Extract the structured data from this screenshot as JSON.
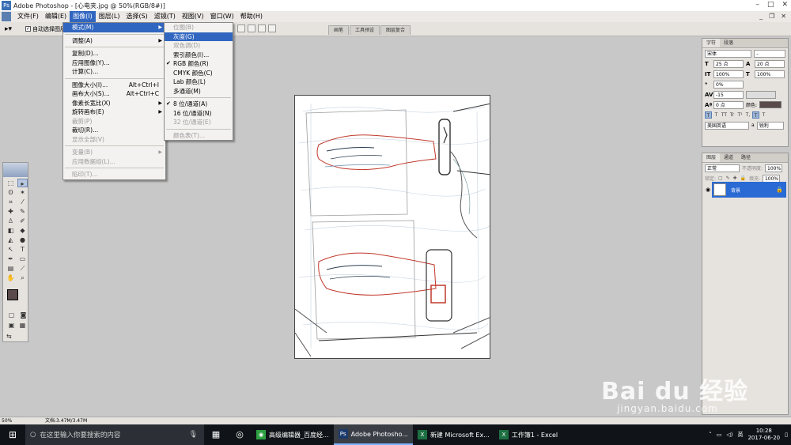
{
  "window": {
    "title": "Adobe Photoshop - [心电夹.jpg @ 50%(RGB/8#)]"
  },
  "menubar": [
    "文件(F)",
    "编辑(E)",
    "图像(I)",
    "图层(L)",
    "选择(S)",
    "滤镜(T)",
    "视图(V)",
    "窗口(W)",
    "帮助(H)"
  ],
  "options": {
    "auto_select": "自动选择图层",
    "tabs": [
      "画笔",
      "工具预设",
      "图层复合"
    ]
  },
  "image_menu": [
    {
      "label": "模式(M)",
      "arrow": true,
      "hl": true
    },
    {
      "sep": true
    },
    {
      "label": "调整(A)",
      "arrow": true
    },
    {
      "sep": true
    },
    {
      "label": "复制(D)..."
    },
    {
      "label": "应用图像(Y)..."
    },
    {
      "label": "计算(C)..."
    },
    {
      "sep": true
    },
    {
      "label": "图像大小(I)...",
      "sc": "Alt+Ctrl+I"
    },
    {
      "label": "画布大小(S)...",
      "sc": "Alt+Ctrl+C"
    },
    {
      "label": "像素长宽比(X)",
      "arrow": true
    },
    {
      "label": "旋转画布(E)",
      "arrow": true
    },
    {
      "label": "裁剪(P)",
      "disabled": true
    },
    {
      "label": "裁切(R)..."
    },
    {
      "label": "显示全部(V)",
      "disabled": true
    },
    {
      "sep": true
    },
    {
      "label": "变量(B)",
      "arrow": true,
      "disabled": true
    },
    {
      "label": "应用数据组(L)...",
      "disabled": true
    },
    {
      "sep": true
    },
    {
      "label": "陷印(T)...",
      "disabled": true
    }
  ],
  "mode_menu": [
    {
      "label": "位图(B)",
      "disabled": true
    },
    {
      "label": "灰度(G)",
      "hl": true
    },
    {
      "label": "双色调(D)",
      "disabled": true
    },
    {
      "label": "索引颜色(I)..."
    },
    {
      "label": "RGB 颜色(R)",
      "check": true
    },
    {
      "label": "CMYK 颜色(C)"
    },
    {
      "label": "Lab 颜色(L)"
    },
    {
      "label": "多通道(M)"
    },
    {
      "sep": true
    },
    {
      "label": "8 位/通道(A)",
      "check": true
    },
    {
      "label": "16 位/通道(N)"
    },
    {
      "label": "32 位/通道(E)",
      "disabled": true
    },
    {
      "sep": true
    },
    {
      "label": "颜色表(T)...",
      "disabled": true
    }
  ],
  "char_panel": {
    "tabs": [
      "字符",
      "段落"
    ],
    "font": "宋体",
    "style": "-",
    "size": "25 点",
    "leading": "20 点",
    "scale_v": "100%",
    "scale_h": "100%",
    "tracking_a": "0%",
    "tracking_b": "-15",
    "baseline": "0 点",
    "color_label": "颜色:",
    "language": "美国英语",
    "aa_label": "a",
    "aa": "锐利",
    "style_btns": [
      "T",
      "T",
      "TT",
      "Tr",
      "T¹",
      "T,",
      "T",
      "T"
    ]
  },
  "layers_panel": {
    "tabs": [
      "图层",
      "通道",
      "路径"
    ],
    "blend": "正常",
    "opacity_label": "不透明度:",
    "opacity": "100%",
    "lock_label": "锁定:",
    "fill_label": "填充:",
    "fill": "100%",
    "layer_name": "背景"
  },
  "status": {
    "zoom": "50%",
    "docsize": "文档:3.47M/3.47M"
  },
  "taskbar": {
    "search_placeholder": "在这里输入你要搜索的内容",
    "apps": [
      {
        "label": "高级编辑器_百度经...",
        "icon": "◉"
      },
      {
        "label": "Adobe Photosho...",
        "icon": "Ps",
        "active": true
      },
      {
        "label": "新建 Microsoft Ex...",
        "icon": "X"
      },
      {
        "label": "工作簿1 - Excel",
        "icon": "X"
      }
    ],
    "ime": "英",
    "time": "10:28",
    "date": "2017-06-20"
  },
  "watermark": {
    "logo": "Bai du 经验",
    "url": "jingyan.baidu.com"
  }
}
